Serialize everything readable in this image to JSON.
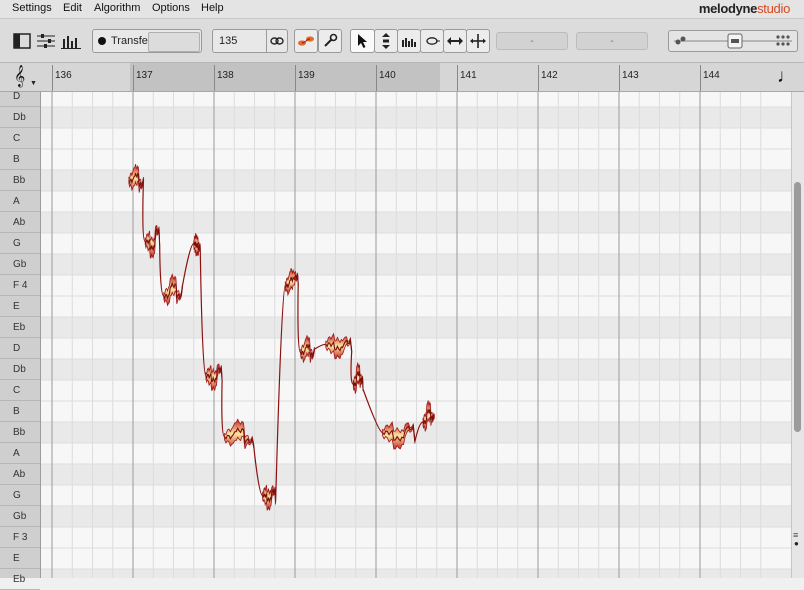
{
  "menu": {
    "items": [
      "Settings",
      "Edit",
      "Algorithm",
      "Options",
      "Help"
    ],
    "brand": "melodyne",
    "brand_edition": "studio"
  },
  "toolbar": {
    "transfer_label": "Transfer",
    "tempo_value": "135",
    "field_a": "-",
    "field_b": "-"
  },
  "ruler": {
    "bars": [
      "136",
      "137",
      "138",
      "139",
      "140",
      "141",
      "142",
      "143",
      "144"
    ]
  },
  "pitch_keys": [
    "D",
    "Db",
    "C",
    "B",
    "Bb",
    "A",
    "Ab",
    "G",
    "Gb",
    "F 4",
    "E",
    "Eb",
    "D",
    "Db",
    "C",
    "B",
    "Bb",
    "A",
    "Ab",
    "G",
    "Gb",
    "F 3",
    "E",
    "Eb"
  ],
  "blobs": [
    {
      "bar": 136.95,
      "len": 0.18,
      "pitch": 4,
      "drift": [
        0.0,
        -0.25,
        0.2,
        -0.1
      ]
    },
    {
      "bar": 137.15,
      "len": 0.18,
      "pitch": 6.9,
      "drift": [
        0.0,
        0.3,
        -0.5,
        0.2
      ]
    },
    {
      "bar": 137.38,
      "len": 0.23,
      "pitch": 9.2,
      "drift": [
        0.3,
        -0.2,
        0.3,
        -0.2
      ]
    },
    {
      "bar": 137.75,
      "len": 0.08,
      "pitch": 7.0,
      "drift": [
        0,
        0.1,
        0.2,
        0.1
      ]
    },
    {
      "bar": 137.9,
      "len": 0.2,
      "pitch": 13.3,
      "drift": [
        0,
        0.2,
        -0.3,
        0.2
      ]
    },
    {
      "bar": 138.13,
      "len": 0.36,
      "pitch": 16.2,
      "drift": [
        0.0,
        -0.3,
        0.2,
        0.4
      ]
    },
    {
      "bar": 138.6,
      "len": 0.16,
      "pitch": 19.0,
      "drift": [
        0,
        0.2,
        -0.2,
        0.3
      ]
    },
    {
      "bar": 138.88,
      "len": 0.16,
      "pitch": 8.6,
      "drift": [
        0.4,
        0.1,
        0.0,
        0.3
      ]
    },
    {
      "bar": 139.07,
      "len": 0.17,
      "pitch": 12.0,
      "drift": [
        0.2,
        -0.1,
        0.3,
        0.0
      ]
    },
    {
      "bar": 139.38,
      "len": 0.32,
      "pitch": 11.8,
      "drift": [
        0.0,
        0.2,
        -0.1,
        0.3
      ]
    },
    {
      "bar": 139.72,
      "len": 0.12,
      "pitch": 13.5,
      "drift": [
        0.2,
        -0.3,
        0.0,
        0.4
      ]
    },
    {
      "bar": 140.08,
      "len": 0.4,
      "pitch": 16.0,
      "drift": [
        0.0,
        0.3,
        -0.2,
        0.4
      ]
    },
    {
      "bar": 140.58,
      "len": 0.14,
      "pitch": 15.2,
      "drift": [
        0.3,
        -0.2,
        0.1,
        0.0
      ]
    }
  ]
}
